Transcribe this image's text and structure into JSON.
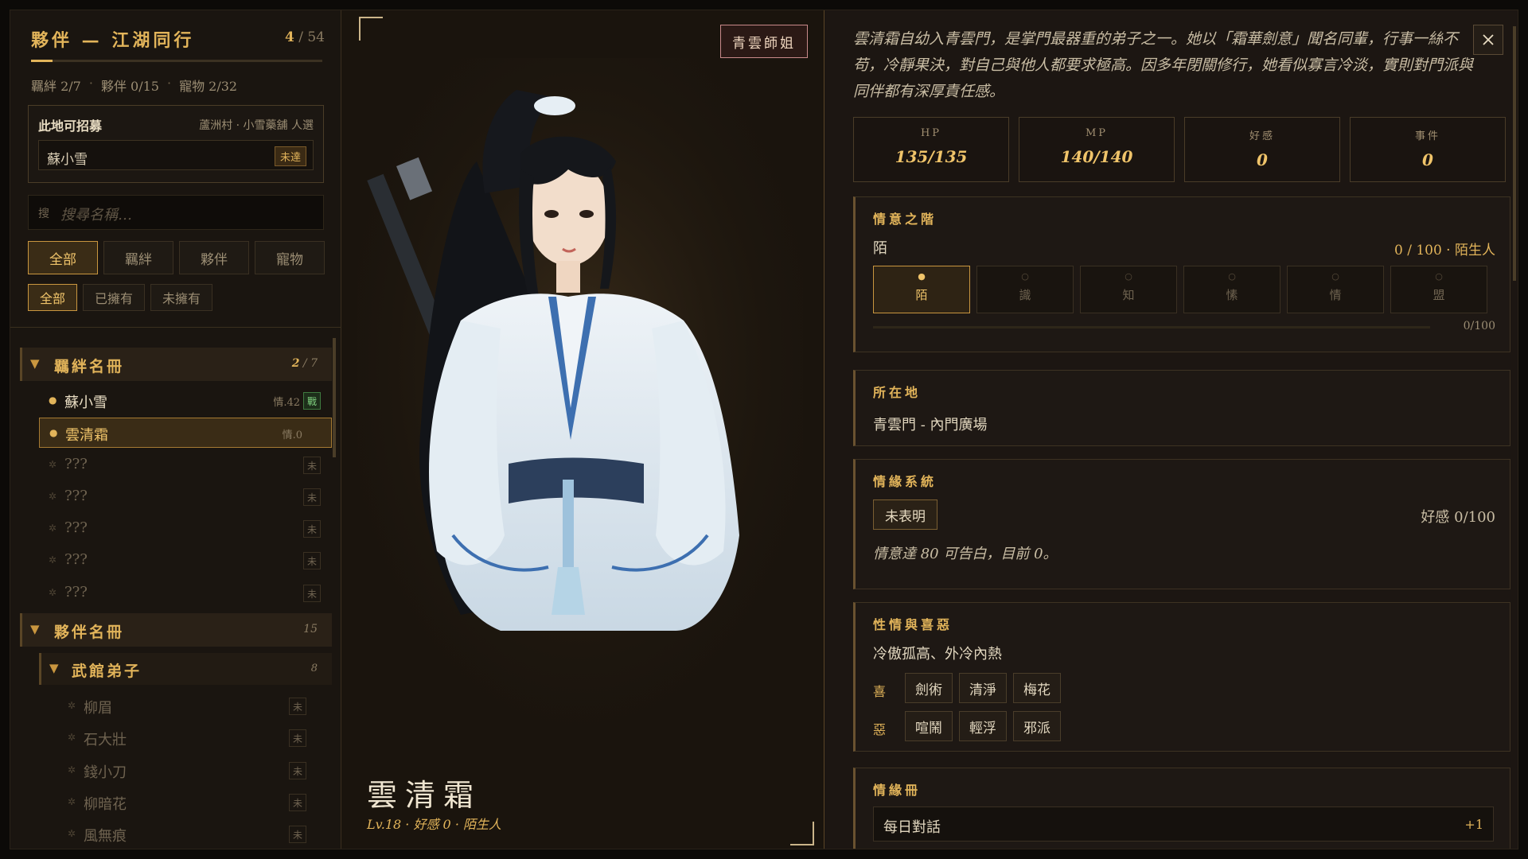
{
  "left": {
    "title": "夥伴 — 江湖同行",
    "count_current": "4",
    "count_total": "/ 54",
    "progress": 0.074,
    "stats": [
      "羈絆 2/7",
      "夥伴 0/15",
      "寵物 2/32"
    ],
    "stat_sep": "·",
    "recruit": {
      "heading": "此地可招募",
      "source": "蘆洲村 · 小雪藥舖 人選",
      "name": "蘇小雪",
      "badge": "未達"
    },
    "search": {
      "icon_text": "搜",
      "placeholder": "搜尋名稱…"
    },
    "tabs": [
      "全部",
      "羈絆",
      "夥伴",
      "寵物"
    ],
    "filters": [
      "全部",
      "已擁有",
      "未擁有"
    ],
    "sections": {
      "bond": {
        "title": "羈絆名冊",
        "count_current": "2",
        "count_total": "/ 7"
      },
      "partner": {
        "title": "夥伴名冊",
        "count": "15"
      },
      "school": {
        "title": "武館弟子",
        "count": "8"
      }
    },
    "bond_items": [
      {
        "name": "蘇小雪",
        "value": "情.42",
        "badge": "戰"
      },
      {
        "name": "雲清霜",
        "value": "情.0",
        "badge": ""
      },
      {
        "name": "???",
        "value": "",
        "badge": "未"
      },
      {
        "name": "???",
        "value": "",
        "badge": "未"
      },
      {
        "name": "???",
        "value": "",
        "badge": "未"
      },
      {
        "name": "???",
        "value": "",
        "badge": "未"
      },
      {
        "name": "???",
        "value": "",
        "badge": "未"
      }
    ],
    "school_items": [
      {
        "name": "柳眉",
        "badge": "未"
      },
      {
        "name": "石大壯",
        "badge": "未"
      },
      {
        "name": "錢小刀",
        "badge": "未"
      },
      {
        "name": "柳暗花",
        "badge": "未"
      },
      {
        "name": "風無痕",
        "badge": "未"
      }
    ]
  },
  "portrait": {
    "badge": "青雲師姐",
    "name": "雲清霜",
    "subtitle": "Lv.18 · 好感 0 · 陌生人"
  },
  "right": {
    "description": "雲清霜自幼入青雲門，是掌門最器重的弟子之一。她以「霜華劍意」聞名同輩，行事一絲不苟，冷靜果決，對自己與他人都要求極高。因多年閉關修行，她看似寡言冷淡，實則對門派與同伴都有深厚責任感。",
    "stats": [
      {
        "label": "HP",
        "value": "135/135"
      },
      {
        "label": "MP",
        "value": "140/140"
      },
      {
        "label": "好感",
        "value": "0"
      },
      {
        "label": "事件",
        "value": "0"
      }
    ],
    "affection_stage": {
      "heading": "情意之階",
      "current": "陌",
      "progress_text": "0 / 100 · 陌生人",
      "stages": [
        "陌",
        "識",
        "知",
        "愫",
        "情",
        "盟"
      ],
      "active_index": 0,
      "bar_text": "0/100",
      "bar_fraction": 0
    },
    "location": {
      "heading": "所在地",
      "value": "青雲門 - 內門廣場"
    },
    "romance": {
      "heading": "情緣系統",
      "status": "未表明",
      "favor": "好感 0/100",
      "note": "情意達 80 可告白，目前 0。"
    },
    "personality": {
      "heading": "性情與喜惡",
      "traits": "冷傲孤高、外冷內熱",
      "like_label": "喜",
      "likes": [
        "劍術",
        "清淨",
        "梅花"
      ],
      "dislike_label": "惡",
      "dislikes": [
        "喧鬧",
        "輕浮",
        "邪派"
      ]
    },
    "events": {
      "heading": "情緣冊",
      "row_label": "每日對話",
      "row_value": "+1"
    }
  },
  "colors": {
    "accent": "#e2b45a",
    "panel": "#1a1510",
    "badge_border": "#c98a8a",
    "active_green": "#7fd07f"
  }
}
